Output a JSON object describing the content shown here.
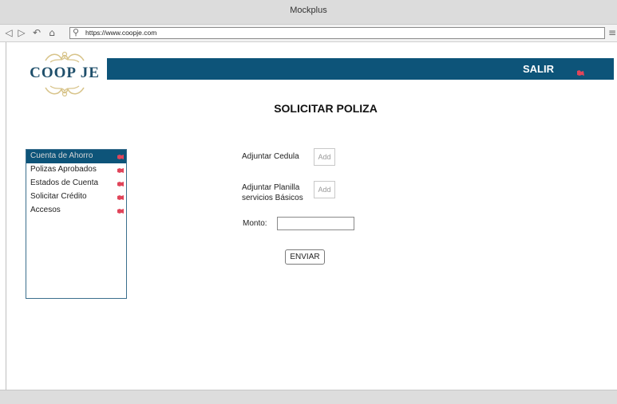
{
  "window": {
    "title": "Mockplus"
  },
  "browser": {
    "url": "https://www.coopje.com"
  },
  "header": {
    "logo_text": "COOP JE",
    "logout_label": "SALIR"
  },
  "page": {
    "title": "SOLICITAR POLIZA"
  },
  "sidebar": {
    "items": [
      {
        "label": "Cuenta de Ahorro",
        "active": true
      },
      {
        "label": "Polizas Aprobados",
        "active": false
      },
      {
        "label": "Estados de Cuenta",
        "active": false
      },
      {
        "label": "Solicitar Crédito",
        "active": false
      },
      {
        "label": "Accesos",
        "active": false
      }
    ]
  },
  "form": {
    "cedula_label": "Adjuntar Cedula",
    "cedula_button": "Add",
    "planilla_label_line1": "Adjuntar Planilla",
    "planilla_label_line2": "servicios Básicos",
    "planilla_button": "Add",
    "monto_label": "Monto:",
    "monto_value": "",
    "submit_label": "ENVIAR"
  },
  "colors": {
    "brand": "#0d5479",
    "accent": "#d94a5a"
  }
}
